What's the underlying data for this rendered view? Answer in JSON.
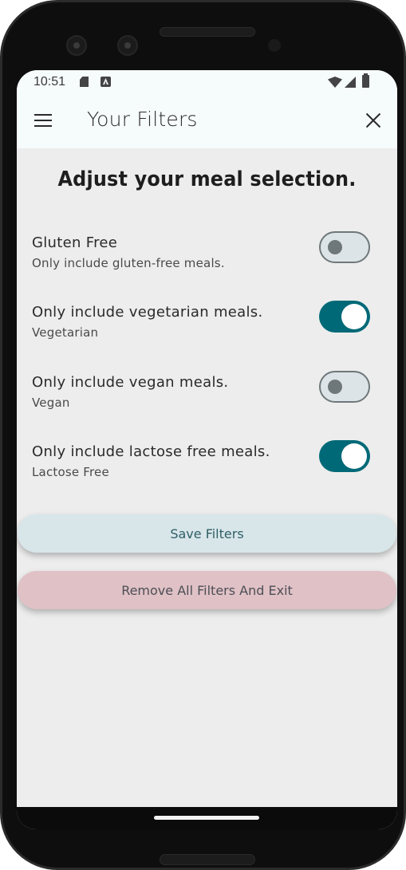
{
  "status_bar": {
    "time": "10:51",
    "icons": [
      "sd-card-icon",
      "a-icon",
      "wifi-icon",
      "signal-icon",
      "battery-icon"
    ]
  },
  "app_bar": {
    "title": "Your Filters",
    "menu_icon": "menu-icon",
    "close_icon": "close-icon"
  },
  "main": {
    "headline": "Adjust your meal selection.",
    "filters": [
      {
        "title": "Gluten Free",
        "subtitle": "Only include gluten-free meals.",
        "enabled": false
      },
      {
        "title": "Only include vegetarian meals.",
        "subtitle": "Vegetarian",
        "enabled": true
      },
      {
        "title": "Only include vegan meals.",
        "subtitle": "Vegan",
        "enabled": false
      },
      {
        "title": "Only include lactose free meals.",
        "subtitle": "Lactose Free",
        "enabled": true
      }
    ],
    "save_button": "Save Filters",
    "remove_button": "Remove All Filters And Exit"
  },
  "colors": {
    "accent": "#006977",
    "app_bar_bg": "#f6fbfc",
    "screen_bg": "#ededed",
    "save_button_bg": "#d8e6ea",
    "remove_button_bg": "#dfc1c6"
  }
}
